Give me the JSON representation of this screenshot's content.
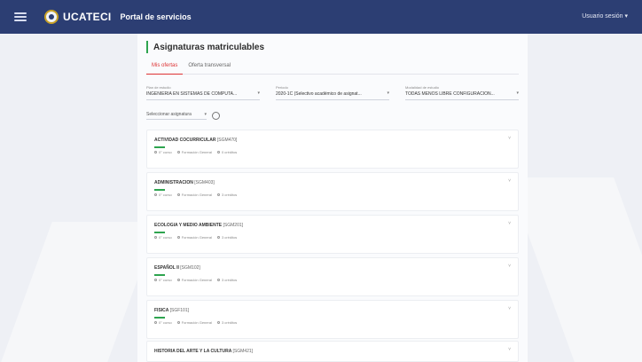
{
  "header": {
    "logo_text": "UCATECI",
    "portal_title": "Portal de servicios",
    "user_menu": "Usuario sesión ▾"
  },
  "page": {
    "title": "Asignaturas matriculables",
    "tabs": [
      {
        "label": "Mis ofertas",
        "active": true
      },
      {
        "label": "Oferta transversal",
        "active": false
      }
    ]
  },
  "filters": [
    {
      "label": "Plan de estudio",
      "value": "INGENIERÍA EN SISTEMAS DE COMPUTA..."
    },
    {
      "label": "Periodo",
      "value": "2020-1C (Selectivo académico de asignat..."
    },
    {
      "label": "Modalidad de estudio",
      "value": "TODAS MENOS LIBRE CONFIGURACIÓN..."
    }
  ],
  "select": {
    "value": "Seleccionar asignatura"
  },
  "courses": [
    {
      "name": "ACTIVIDAD COCURRICULAR",
      "code": "[SGM470]",
      "m1": "0° curso",
      "m2": "Formación General",
      "m3": "0 créditos"
    },
    {
      "name": "ADMINISTRACION",
      "code": "[SGM403]",
      "m1": "0° curso",
      "m2": "Formación General",
      "m3": "3 créditos"
    },
    {
      "name": "ECOLOGIA Y MEDIO AMBIENTE",
      "code": "[SGM201]",
      "m1": "0° curso",
      "m2": "Formación General",
      "m3": "3 créditos"
    },
    {
      "name": "ESPAÑOL II",
      "code": "[SGM102]",
      "m1": "0° curso",
      "m2": "Formación General",
      "m3": "3 créditos"
    },
    {
      "name": "FISICA",
      "code": "[SGF101]",
      "m1": "0° curso",
      "m2": "Formación General",
      "m3": "3 créditos"
    },
    {
      "name": "HISTORIA DEL ARTE Y LA CULTURA",
      "code": "[SGM421]",
      "m1": "0° curso",
      "m2": "Formación General",
      "m3": "3 créditos"
    }
  ]
}
